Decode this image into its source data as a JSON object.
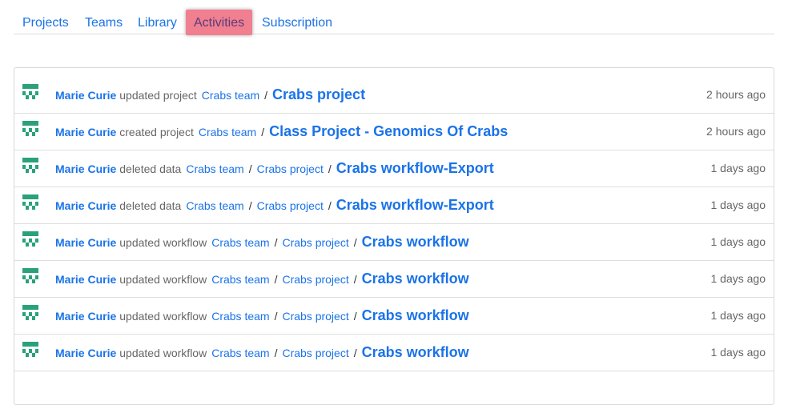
{
  "tabs": [
    {
      "label": "Projects"
    },
    {
      "label": "Teams"
    },
    {
      "label": "Library"
    },
    {
      "label": "Activities"
    },
    {
      "label": "Subscription"
    }
  ],
  "colors": {
    "link": "#1a73e8",
    "active_tab_bg": "#f07f8f",
    "avatar": "#2aa17a"
  },
  "activities": [
    {
      "user": "Marie Curie",
      "action": "updated project",
      "crumbs": [
        "Crabs team"
      ],
      "target": "Crabs project",
      "time": "2 hours ago",
      "icon": "user-avatar-icon"
    },
    {
      "user": "Marie Curie",
      "action": "created project",
      "crumbs": [
        "Crabs team"
      ],
      "target": "Class Project - Genomics Of Crabs",
      "time": "2 hours ago",
      "icon": "user-avatar-icon"
    },
    {
      "user": "Marie Curie",
      "action": "deleted data",
      "crumbs": [
        "Crabs team",
        "Crabs project"
      ],
      "target": "Crabs workflow-Export",
      "time": "1 days ago",
      "icon": "user-avatar-icon"
    },
    {
      "user": "Marie Curie",
      "action": "deleted data",
      "crumbs": [
        "Crabs team",
        "Crabs project"
      ],
      "target": "Crabs workflow-Export",
      "time": "1 days ago",
      "icon": "user-avatar-icon"
    },
    {
      "user": "Marie Curie",
      "action": "updated workflow",
      "crumbs": [
        "Crabs team",
        "Crabs project"
      ],
      "target": "Crabs workflow",
      "time": "1 days ago",
      "icon": "user-avatar-icon"
    },
    {
      "user": "Marie Curie",
      "action": "updated workflow",
      "crumbs": [
        "Crabs team",
        "Crabs project"
      ],
      "target": "Crabs workflow",
      "time": "1 days ago",
      "icon": "user-avatar-icon"
    },
    {
      "user": "Marie Curie",
      "action": "updated workflow",
      "crumbs": [
        "Crabs team",
        "Crabs project"
      ],
      "target": "Crabs workflow",
      "time": "1 days ago",
      "icon": "user-avatar-icon"
    },
    {
      "user": "Marie Curie",
      "action": "updated workflow",
      "crumbs": [
        "Crabs team",
        "Crabs project"
      ],
      "target": "Crabs workflow",
      "time": "1 days ago",
      "icon": "user-avatar-icon"
    }
  ]
}
